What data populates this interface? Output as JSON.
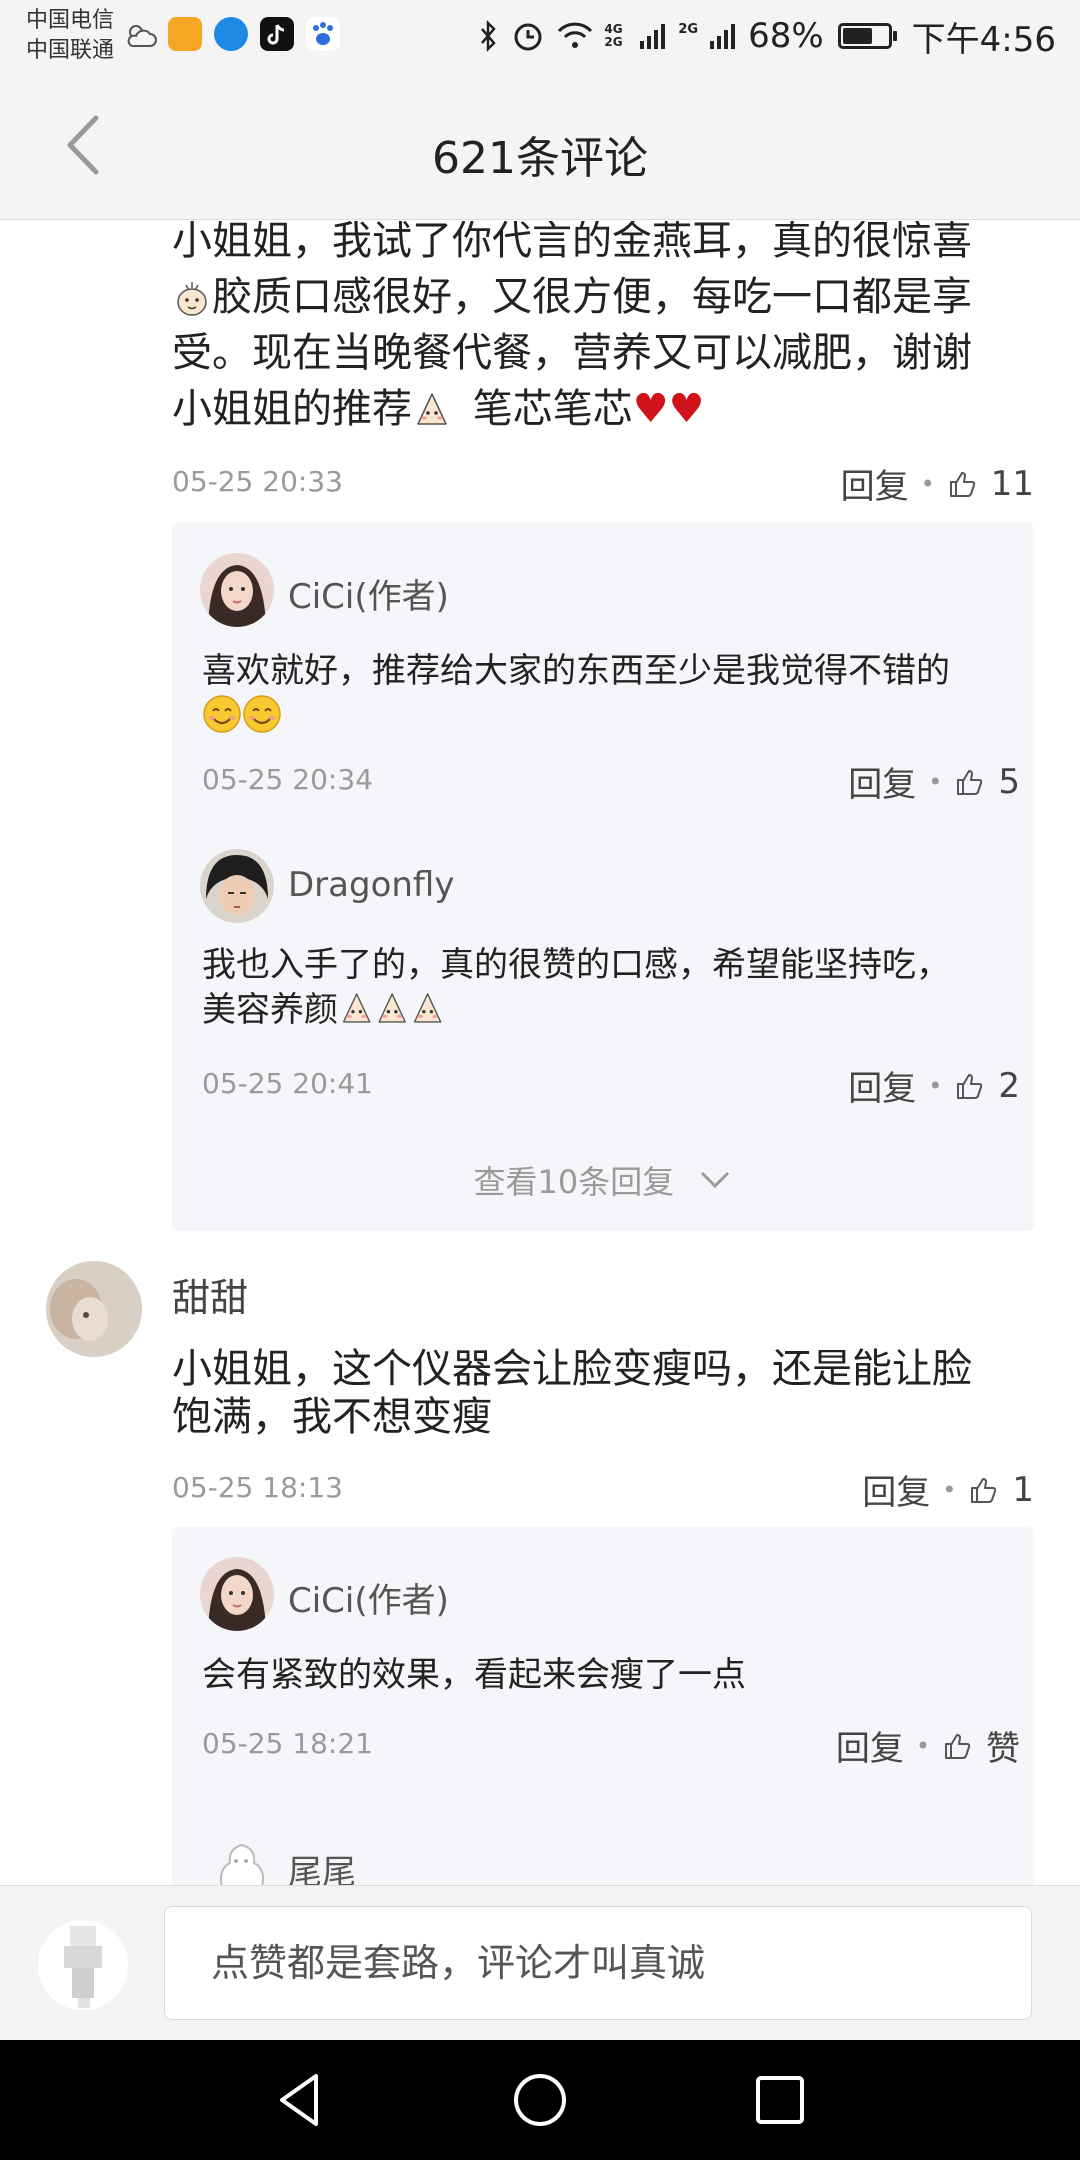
{
  "status_bar": {
    "carrier_1": "中国电信",
    "carrier_2": "中国联通",
    "network_1": "4G 2G",
    "network_2": "2G",
    "battery": "68%",
    "time": "下午4:56",
    "app_icons": [
      "weather-icon",
      "app-icon",
      "zhihu-icon",
      "tiktok-icon",
      "baidu-icon"
    ]
  },
  "header": {
    "title": "621条评论"
  },
  "comments": [
    {
      "text_1": "小姐姐，我试了你代言的金燕耳，真的很惊喜",
      "text_2": "胶质口感很好，又很方便，每吃一口都是享",
      "text_3": "受。现在当晚餐代餐，营养又可以减肥，谢谢",
      "text_4": "小姐姐的推荐",
      "text_5": "笔芯笔芯",
      "date": "05-25 20:33",
      "reply_label": "回复",
      "like_count": "11",
      "replies": [
        {
          "user": "CiCi(作者)",
          "text": "喜欢就好，推荐给大家的东西至少是我觉得不错的",
          "date": "05-25 20:34",
          "reply_label": "回复",
          "like_count": "5"
        },
        {
          "user": "Dragonfly",
          "text_1": "我也入手了的，真的很赞的口感，希望能坚持吃，",
          "text_2": "美容养颜",
          "date": "05-25 20:41",
          "reply_label": "回复",
          "like_count": "2"
        }
      ],
      "more_replies": "查看10条回复"
    },
    {
      "user": "甜甜",
      "text_1": "小姐姐，这个仪器会让脸变瘦吗，还是能让脸",
      "text_2": "饱满，我不想变瘦",
      "date": "05-25 18:13",
      "reply_label": "回复",
      "like_count": "1",
      "replies": [
        {
          "user": "CiCi(作者)",
          "text": "会有紧致的效果，看起来会瘦了一点",
          "date": "05-25 18:21",
          "reply_label": "回复",
          "like_count": "赞"
        },
        {
          "user": "尾尾"
        }
      ]
    }
  ],
  "input": {
    "placeholder": "点赞都是套路，评论才叫真诚"
  },
  "colors": {
    "background": "#ffffff",
    "bar": "#f4f4f4",
    "reply_box": "#f5f6f9",
    "heart": "#d0121b",
    "meta": "#9a9a9a"
  }
}
